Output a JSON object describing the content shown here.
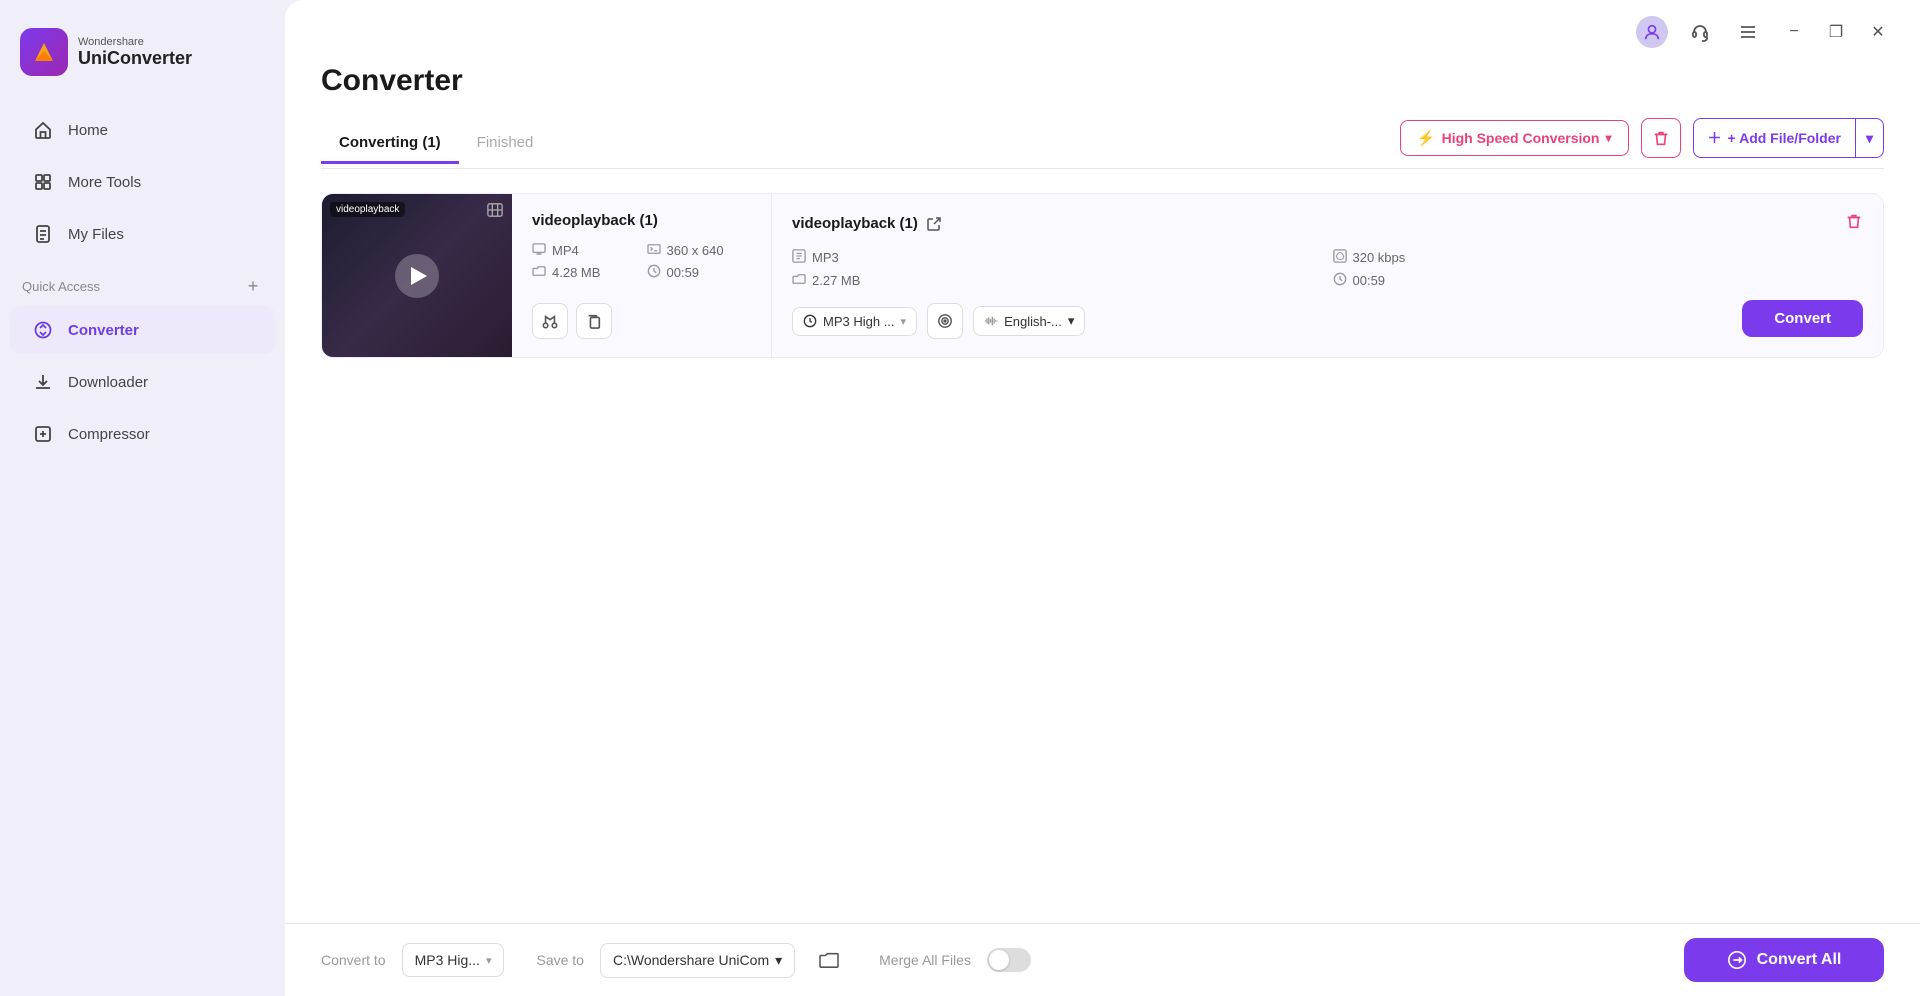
{
  "app": {
    "brand": "Wondershare",
    "product": "UniConverter"
  },
  "window_controls": {
    "minimize_label": "−",
    "restore_label": "❐",
    "close_label": "✕"
  },
  "sidebar": {
    "nav_items": [
      {
        "id": "home",
        "label": "Home",
        "icon": "home"
      },
      {
        "id": "more-tools",
        "label": "More Tools",
        "icon": "grid"
      },
      {
        "id": "my-files",
        "label": "My Files",
        "icon": "file"
      }
    ],
    "section_label": "Quick Access",
    "quick_access_items": [
      {
        "id": "converter",
        "label": "Converter",
        "icon": "convert",
        "active": true
      },
      {
        "id": "downloader",
        "label": "Downloader",
        "icon": "download"
      },
      {
        "id": "compressor",
        "label": "Compressor",
        "icon": "compress"
      }
    ]
  },
  "page": {
    "title": "Converter"
  },
  "tabs": {
    "converting_label": "Converting (1)",
    "finished_label": "Finished",
    "active": "converting"
  },
  "toolbar": {
    "high_speed_label": "High Speed Conversion",
    "delete_tooltip": "Delete",
    "add_file_label": "+ Add File/Folder"
  },
  "file_item": {
    "source": {
      "name": "videoplayback (1)",
      "format": "MP4",
      "size": "4.28 MB",
      "resolution": "360 x 640",
      "duration": "00:59"
    },
    "output": {
      "name": "videoplayback (1)",
      "format": "MP3",
      "bitrate": "320 kbps",
      "size": "2.27 MB",
      "duration": "00:59",
      "quality": "MP3 High ...",
      "language": "English-..."
    },
    "convert_btn_label": "Convert"
  },
  "bottom_bar": {
    "convert_to_label": "Convert to",
    "format_value": "MP3 Hig...",
    "save_to_label": "Save to",
    "save_path": "C:\\Wondershare UniCom",
    "merge_label": "Merge All Files",
    "convert_all_label": "Convert All"
  }
}
